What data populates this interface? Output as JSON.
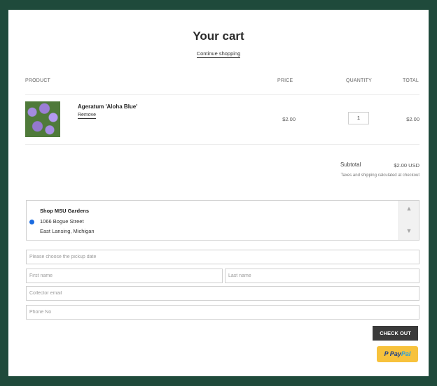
{
  "cart": {
    "title": "Your cart",
    "continue_label": "Continue shopping"
  },
  "table": {
    "headers": {
      "product": "PRODUCT",
      "price": "PRICE",
      "quantity": "QUANTITY",
      "total": "TOTAL"
    },
    "items": [
      {
        "name": "Ageratum 'Aloha Blue'",
        "remove_label": "Remove",
        "price": "$2.00",
        "quantity": "1",
        "total": "$2.00"
      }
    ]
  },
  "summary": {
    "subtotal_label": "Subtotal",
    "subtotal_value": "$2.00 USD",
    "tax_note": "Taxes and shipping calculated at checkout"
  },
  "pickup": {
    "store_name": "Shop MSU Gardens",
    "address_line1": "1066 Bogue Street",
    "address_line2": "East Lansing, Michigan",
    "selected": true
  },
  "form": {
    "pickup_date_placeholder": "Please choose the pickup date",
    "first_name_placeholder": "First name",
    "last_name_placeholder": "Last name",
    "email_placeholder": "Collector email",
    "phone_placeholder": "Phone No"
  },
  "actions": {
    "checkout_label": "CHECK OUT",
    "paypal_brand_first": "P Pay",
    "paypal_brand_second": "Pal"
  },
  "colors": {
    "frame_background": "#1f4a3b",
    "checkout_button": "#3a3a3a",
    "paypal_button": "#f7c23c",
    "radio_accent": "#1a6be0"
  }
}
